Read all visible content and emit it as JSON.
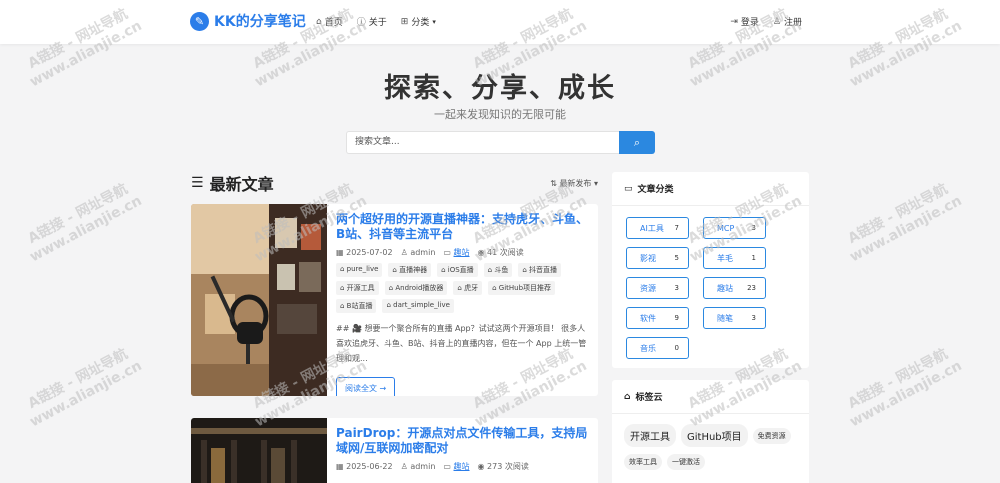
{
  "header": {
    "logo_icon": "pencil-icon",
    "site_name": "KK的分享笔记",
    "nav": [
      {
        "label": "首页",
        "icon": "home-icon"
      },
      {
        "label": "关于",
        "icon": "info-icon"
      },
      {
        "label": "分类",
        "icon": "grid-icon"
      }
    ],
    "login": "登录",
    "register": "注册"
  },
  "hero": {
    "title": "探索、分享、成长",
    "subtitle": "一起来发现知识的无限可能",
    "search_placeholder": "搜索文章..."
  },
  "main": {
    "section_title": "最新文章",
    "sort_label": "最新发布",
    "articles": [
      {
        "title": "两个超好用的开源直播神器：支持虎牙、斗鱼、B站、抖音等主流平台",
        "date": "2025-07-02",
        "author": "admin",
        "category": "趣站",
        "views": "41 次阅读",
        "tags": [
          "pure_live",
          "直播神器",
          "iOS直播",
          "斗鱼",
          "抖音直播",
          "开源工具",
          "Android播放器",
          "虎牙",
          "GitHub项目推荐",
          "B站直播",
          "dart_simple_live"
        ],
        "excerpt": "## 🎥 想要一个聚合所有的直播 App？试试这两个开源项目！ 很多人喜欢追虎牙、斗鱼、B站、抖音上的直播内容，但在一个 App 上统一管理和观...",
        "read_more": "阅读全文 →"
      },
      {
        "title": "PairDrop：开源点对点文件传输工具，支持局域网/互联网加密配对",
        "date": "2025-06-22",
        "author": "admin",
        "category": "趣站",
        "views": "273 次阅读"
      }
    ]
  },
  "sidebar": {
    "categories_title": "文章分类",
    "categories": [
      {
        "name": "AI工具",
        "count": "7"
      },
      {
        "name": "MCP",
        "count": "3"
      },
      {
        "name": "影视",
        "count": "5"
      },
      {
        "name": "羊毛",
        "count": "1"
      },
      {
        "name": "资源",
        "count": "3"
      },
      {
        "name": "趣站",
        "count": "23"
      },
      {
        "name": "软件",
        "count": "9"
      },
      {
        "name": "随笔",
        "count": "3"
      },
      {
        "name": "音乐",
        "count": "0"
      }
    ],
    "tags_title": "标签云",
    "tags_big": [
      "开源工具",
      "GitHub项目"
    ],
    "tags_small": [
      "免费资源",
      "效率工具",
      "一键激活"
    ]
  },
  "watermark": {
    "line1": "A链接 - 网址导航",
    "line2": "www.alianjie.cn"
  },
  "colors": {
    "accent": "#2b7de9",
    "background": "#f4f4f5"
  }
}
